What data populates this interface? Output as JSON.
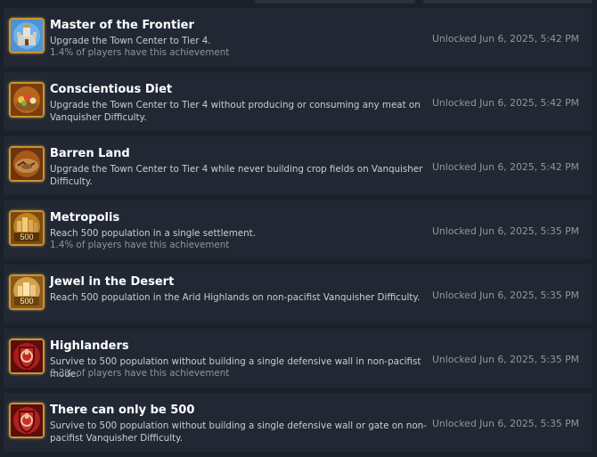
{
  "achievements": [
    {
      "icon": "castle-icon",
      "title": "Master of the Frontier",
      "description": "Upgrade the Town Center to Tier 4.",
      "percent": "1.4% of players have this achievement",
      "unlocked": "Unlocked Jun 6, 2025, 5:42 PM"
    },
    {
      "icon": "food-basket-icon",
      "title": "Conscientious Diet",
      "description": "Upgrade the Town Center to Tier 4 without producing or consuming any meat on Vanquisher Difficulty.",
      "percent": "",
      "unlocked": "Unlocked Jun 6, 2025, 5:42 PM"
    },
    {
      "icon": "barren-land-icon",
      "title": "Barren Land",
      "description": "Upgrade the Town Center to Tier 4 while never building crop fields on Vanquisher Difficulty.",
      "percent": "",
      "unlocked": "Unlocked Jun 6, 2025, 5:42 PM"
    },
    {
      "icon": "city-500-icon",
      "badge_text": "500",
      "title": "Metropolis",
      "description": "Reach 500 population in a single settlement.",
      "percent": "1.4% of players have this achievement",
      "unlocked": "Unlocked Jun 6, 2025, 5:35 PM"
    },
    {
      "icon": "desert-city-500-icon",
      "badge_text": "500",
      "title": "Jewel in the Desert",
      "description": "Reach 500 population in the Arid Highlands on non-pacifist Vanquisher Difficulty.",
      "percent": "",
      "unlocked": "Unlocked Jun 6, 2025, 5:35 PM"
    },
    {
      "icon": "red-shield-icon",
      "title": "Highlanders",
      "description": "Survive to 500 population without building a single defensive wall in non-pacifist mode.",
      "percent": "0.3% of players have this achievement",
      "unlocked": "Unlocked Jun 6, 2025, 5:35 PM"
    },
    {
      "icon": "red-shield-icon",
      "title": "There can only be 500",
      "description": "Survive to 500 population without building a single defensive wall or gate on non-pacifist Vanquisher Difficulty.",
      "percent": "",
      "unlocked": "Unlocked Jun 6, 2025, 5:35 PM"
    }
  ],
  "colors": {
    "background": "#1b2029",
    "row": "#222833",
    "badge_border": "#c8962f",
    "title": "#ffffff",
    "description": "#c8ccd2",
    "muted": "#8f969e"
  }
}
